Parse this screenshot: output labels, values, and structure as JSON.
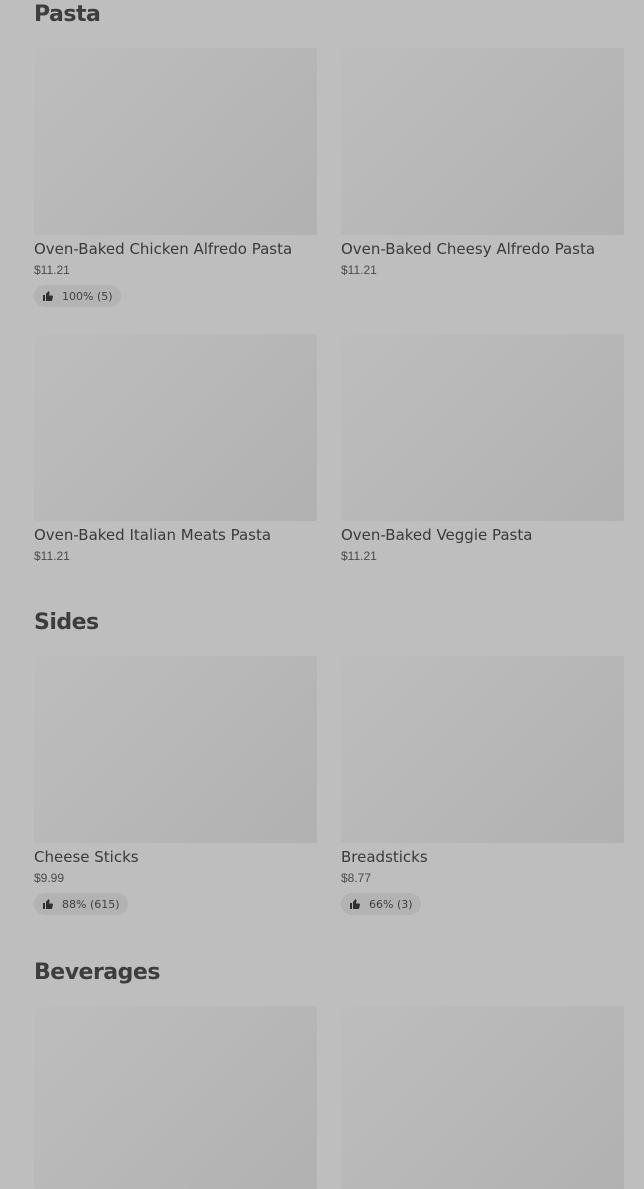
{
  "sections": [
    {
      "title": "Pasta",
      "items": [
        {
          "name": "Oven-Baked Chicken Alfredo Pasta",
          "price": "$11.21",
          "rating": "100% (5)"
        },
        {
          "name": "Oven-Baked Cheesy Alfredo Pasta",
          "price": "$11.21",
          "rating": null
        },
        {
          "name": "Oven-Baked Italian Meats Pasta",
          "price": "$11.21",
          "rating": null
        },
        {
          "name": "Oven-Baked Veggie Pasta",
          "price": "$11.21",
          "rating": null
        }
      ]
    },
    {
      "title": "Sides",
      "items": [
        {
          "name": "Cheese Sticks",
          "price": "$9.99",
          "rating": "88% (615)"
        },
        {
          "name": "Breadsticks",
          "price": "$8.77",
          "rating": "66% (3)"
        }
      ]
    },
    {
      "title": "Beverages",
      "items": [
        {
          "name": "",
          "price": "",
          "rating": null
        },
        {
          "name": "",
          "price": "",
          "rating": null
        }
      ]
    }
  ],
  "icons": {
    "rating": "thumbs-up-icon"
  },
  "colors": {
    "overlay_background": "#bebebe",
    "image_placeholder": "#b8b8b8",
    "rating_pill": "#b3b3b3"
  }
}
